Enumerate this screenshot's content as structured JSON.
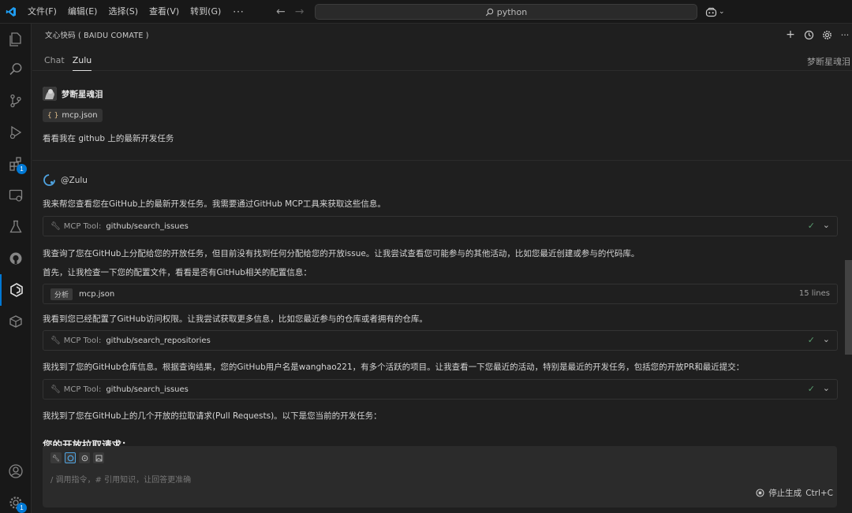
{
  "titlebar": {
    "menu": [
      "文件(F)",
      "编辑(E)",
      "选择(S)",
      "查看(V)",
      "转到(G)"
    ],
    "more": "···",
    "search_text": "python"
  },
  "activitybar": {
    "extensions_badge": "1",
    "settings_badge": "1"
  },
  "panel": {
    "title": "文心快码 ( BAIDU COMATE )",
    "tabs": [
      "Chat",
      "Zulu"
    ],
    "active_tab": "Zulu",
    "user_right": "梦断星魂泪"
  },
  "chat": {
    "user_name": "梦断星魂泪",
    "attached_file": "mcp.json",
    "user_message": "看看我在 github 上的最新开发任务",
    "bot_name": "@Zulu",
    "p1": "我来帮您查看您在GitHub上的最新开发任务。我需要通过GitHub MCP工具来获取这些信息。",
    "tool1_label": "MCP Tool:",
    "tool1_name": "github/search_issues",
    "p2": "我查询了您在GitHub上分配给您的开放任务，但目前没有找到任何分配给您的开放issue。让我尝试查看您可能参与的其他活动，比如您最近创建或参与的代码库。",
    "p3": "首先，让我检查一下您的配置文件，看看是否有GitHub相关的配置信息：",
    "file_tag": "分析",
    "file_name": "mcp.json",
    "file_lines": "15 lines",
    "p4": "我看到您已经配置了GitHub访问权限。让我尝试获取更多信息，比如您最近参与的仓库或者拥有的仓库。",
    "tool2_label": "MCP Tool:",
    "tool2_name": "github/search_repositories",
    "p5": "我找到了您的GitHub仓库信息。根据查询结果，您的GitHub用户名是wanghao221，有多个活跃的项目。让我查看一下您最近的活动，特别是最近的开发任务，包括您的开放PR和最近提交：",
    "tool3_label": "MCP Tool:",
    "tool3_name": "github/search_issues",
    "p6": "我找到了您在GitHub上的几个开放的拉取请求(Pull Requests)。以下是您当前的开发任务：",
    "heading": "您的开放拉取请求："
  },
  "input": {
    "placeholder": "/ 调用指令，# 引用知识，让回答更准确",
    "stop_label": "停止生成",
    "shortcut": "Ctrl+C"
  }
}
